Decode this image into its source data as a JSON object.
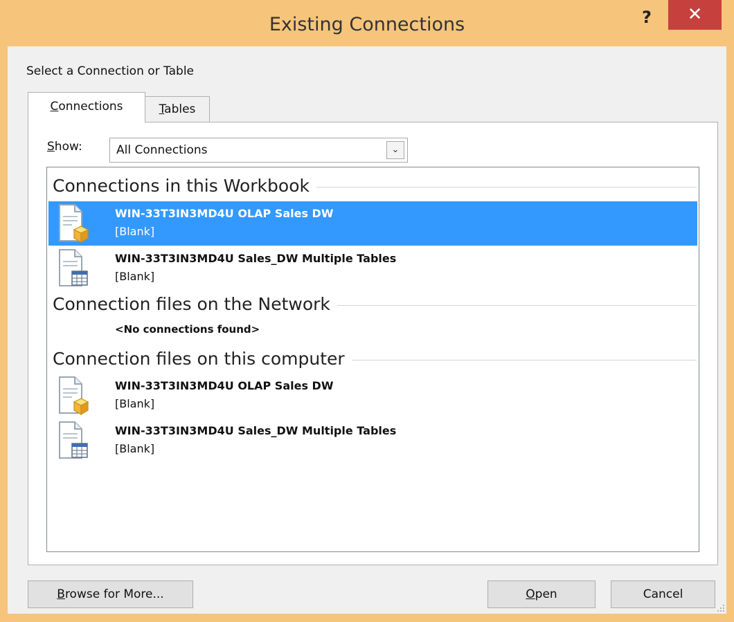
{
  "window": {
    "title": "Existing Connections",
    "help_label": "?",
    "close_label": "✕"
  },
  "header": {
    "section_label": "Select a Connection or Table"
  },
  "tabs": [
    {
      "label": "Connections",
      "accel": "C",
      "rest": "onnections",
      "active": true
    },
    {
      "label": "Tables",
      "accel": "T",
      "rest": "ables",
      "active": false
    }
  ],
  "show": {
    "label": "Show:",
    "accel": "S",
    "rest": "how:",
    "selected": "All Connections"
  },
  "groups": [
    {
      "header": "Connections in this Workbook",
      "items": [
        {
          "name": "WIN-33T3IN3MD4U OLAP Sales DW",
          "description": "[Blank]",
          "icon": "olap-cube-file-icon",
          "selected": true
        },
        {
          "name": "WIN-33T3IN3MD4U Sales_DW Multiple Tables",
          "description": "[Blank]",
          "icon": "table-file-icon",
          "selected": false
        }
      ]
    },
    {
      "header": "Connection files on the Network",
      "empty_text": "<No connections found>"
    },
    {
      "header": "Connection files on this computer",
      "items": [
        {
          "name": "WIN-33T3IN3MD4U OLAP Sales DW",
          "description": "[Blank]",
          "icon": "olap-cube-file-icon",
          "selected": false
        },
        {
          "name": "WIN-33T3IN3MD4U Sales_DW Multiple Tables",
          "description": "[Blank]",
          "icon": "table-file-icon",
          "selected": false
        }
      ]
    }
  ],
  "buttons": {
    "browse": {
      "accel": "B",
      "rest": "rowse for More..."
    },
    "open": {
      "accel": "O",
      "rest": "pen"
    },
    "cancel": {
      "label": "Cancel"
    }
  },
  "colors": {
    "selection": "#3399ff",
    "close_button": "#c6403d",
    "window_frame": "#f6c47b"
  }
}
